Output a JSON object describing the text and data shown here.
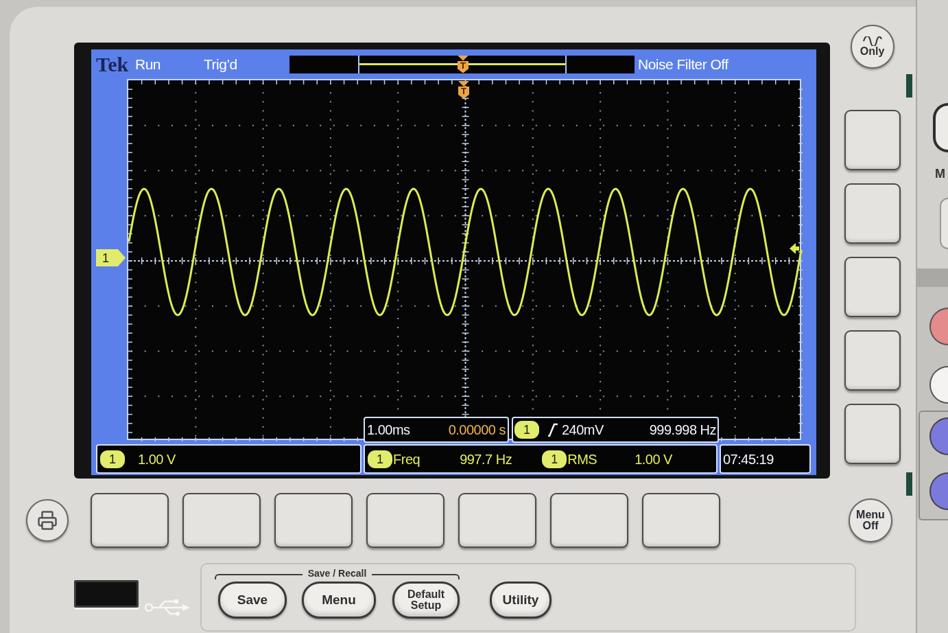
{
  "screen": {
    "status_bar": {
      "brand": "Tek",
      "acquisition_state": "Run",
      "trigger_state": "Trig’d",
      "noise_filter": "Noise Filter Off"
    },
    "record_bar": {
      "trigger_marker": "T"
    },
    "graticule": {
      "trigger_marker": "T",
      "channel_marker": "1"
    },
    "horizontal_readout": {
      "scale": "1.00ms",
      "position": "0.00000 s"
    },
    "trigger_readout": {
      "channel": "1",
      "level": "240mV",
      "frequency": "999.998 Hz"
    },
    "channel_readout": {
      "channel": "1",
      "scale": "1.00 V"
    },
    "measurements": [
      {
        "channel": "1",
        "name": "Freq",
        "value": "997.7 Hz"
      },
      {
        "channel": "1",
        "name": "RMS",
        "value": "1.00 V"
      }
    ],
    "clock": "07:45:19"
  },
  "side_panel": {
    "top_button": "Only",
    "bottom_button": "Menu Off",
    "knob_label": "M"
  },
  "save_recall": {
    "title": "Save / Recall",
    "buttons": [
      "Save",
      "Menu",
      "Default Setup"
    ]
  },
  "utility_button": "Utility"
}
